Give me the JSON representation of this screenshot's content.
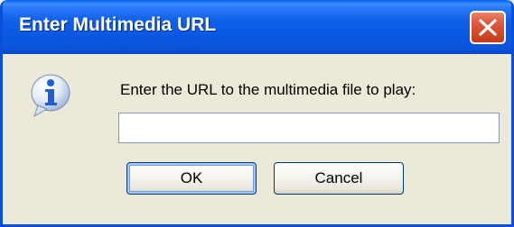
{
  "window": {
    "title": "Enter Multimedia URL"
  },
  "icons": {
    "info": "info-icon",
    "close": "close-icon"
  },
  "dialog": {
    "prompt": "Enter the URL to the multimedia file to play:",
    "url_value": "",
    "url_placeholder": ""
  },
  "buttons": {
    "ok_label": "OK",
    "cancel_label": "Cancel"
  },
  "colors": {
    "titlebar": "#0a58e2",
    "close": "#dc5a3c",
    "face": "#ece9d8",
    "info_blue": "#1f5fd6"
  }
}
